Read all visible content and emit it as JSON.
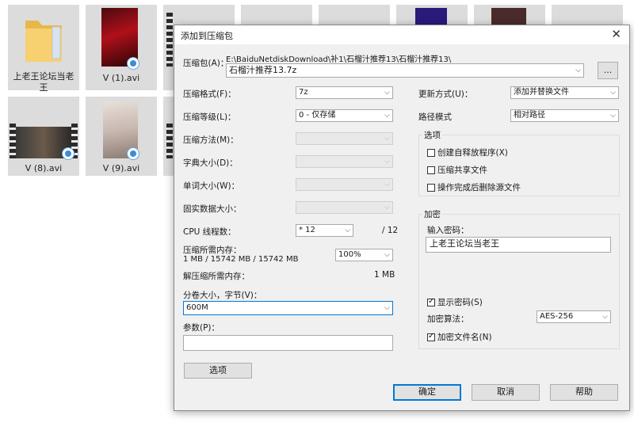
{
  "desktop": {
    "files": [
      {
        "name": "上老王论坛当老王"
      },
      {
        "name": "V (1).avi"
      },
      {
        "name": "V (8).avi"
      },
      {
        "name": "V (9).avi"
      }
    ]
  },
  "dialog": {
    "title": "添加到压缩包",
    "close_glyph": "✕",
    "archive": {
      "label": "压缩包(A)：",
      "path": "E:\\BaiduNetdiskDownload\\补1\\石榴汁推荐13\\石榴汁推荐13\\",
      "name": "石榴汁推荐13.7z",
      "browse_label": "..."
    },
    "format": {
      "label": "压缩格式(F)：",
      "value": "7z"
    },
    "level": {
      "label": "压缩等级(L)：",
      "value": "0 - 仅存储"
    },
    "method": {
      "label": "压缩方法(M)："
    },
    "dict": {
      "label": "字典大小(D)："
    },
    "word": {
      "label": "单词大小(W)："
    },
    "solid": {
      "label": "固实数据大小："
    },
    "cpu": {
      "label": "CPU 线程数：",
      "value": "* 12",
      "max": "/ 12"
    },
    "mem": {
      "label": "压缩所需内存：",
      "detail": "1 MB / 15742 MB / 15742 MB",
      "percent": "100%"
    },
    "demem": {
      "label": "解压缩所需内存：",
      "value": "1 MB"
    },
    "volume": {
      "label": "分卷大小，字节(V)：",
      "value": "600M"
    },
    "params": {
      "label": "参数(P)：",
      "value": ""
    },
    "options_button": "选项",
    "update": {
      "label": "更新方式(U)：",
      "value": "添加并替换文件"
    },
    "path_mode": {
      "label": "路径模式",
      "value": "相对路径"
    },
    "options_group": {
      "title": "选项",
      "sfx": "创建自释放程序(X)",
      "shared": "压缩共享文件",
      "delete": "操作完成后删除源文件"
    },
    "encryption": {
      "title": "加密",
      "pw_label": "输入密码：",
      "password": "上老王论坛当老王",
      "show_pw": "显示密码(S)",
      "method_label": "加密算法：",
      "method_value": "AES-256",
      "encrypt_names": "加密文件名(N)"
    },
    "buttons": {
      "ok": "确定",
      "cancel": "取消",
      "help": "帮助"
    },
    "arrow": "⌵"
  }
}
